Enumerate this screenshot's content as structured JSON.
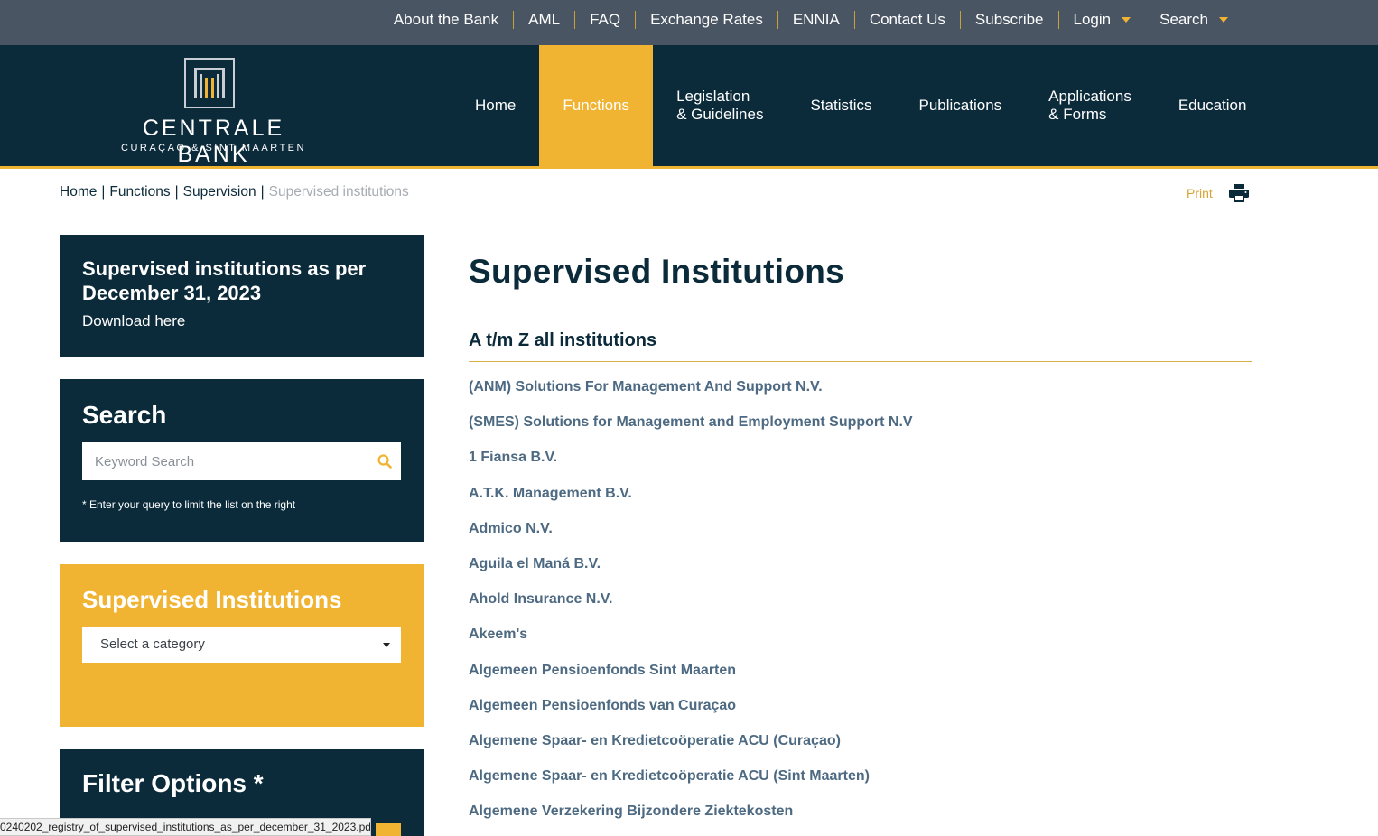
{
  "top_nav": [
    {
      "label": "About the Bank"
    },
    {
      "label": "AML"
    },
    {
      "label": "FAQ"
    },
    {
      "label": "Exchange Rates"
    },
    {
      "label": "ENNIA"
    },
    {
      "label": "Contact Us"
    },
    {
      "label": "Subscribe"
    },
    {
      "label": "Login"
    },
    {
      "label": "Search"
    }
  ],
  "logo": {
    "name": "CENTRALE BANK",
    "sub": "CURAÇAO & SINT MAARTEN"
  },
  "main_nav": [
    {
      "label": "Home"
    },
    {
      "label": "Functions"
    },
    {
      "label": "Legislation",
      "label2": "& Guidelines"
    },
    {
      "label": "Statistics"
    },
    {
      "label": "Publications"
    },
    {
      "label": "Applications",
      "label2": "& Forms"
    },
    {
      "label": "Education"
    }
  ],
  "breadcrumb": {
    "home": "Home",
    "functions": "Functions",
    "supervision": "Supervision",
    "current": "Supervised institutions",
    "sep": "|"
  },
  "print_label": "Print",
  "download_panel": {
    "title": "Supervised institutions as per December 31, 2023",
    "link": "Download here"
  },
  "search_panel": {
    "title": "Search",
    "placeholder": "Keyword Search",
    "note": "* Enter your query to limit the list on the right"
  },
  "category_panel": {
    "title": "Supervised Institutions",
    "select_value": "Select a category"
  },
  "filter_panel": {
    "title": "Filter Options *"
  },
  "content": {
    "title": "Supervised Institutions",
    "section": "A t/m Z all institutions",
    "institutions": [
      "(ANM) Solutions For Management And Support N.V.",
      "(SMES) Solutions for Management and Employment Support N.V",
      "1 Fiansa B.V.",
      "A.T.K. Management B.V.",
      "Admico N.V.",
      "Aguila el Maná B.V.",
      "Ahold Insurance N.V.",
      "Akeem's",
      "Algemeen Pensioenfonds Sint Maarten",
      "Algemeen Pensioenfonds van Curaçao",
      "Algemene Spaar- en Kredietcoöperatie ACU (Curaçao)",
      "Algemene Spaar- en Kredietcoöperatie ACU (Sint Maarten)",
      "Algemene Verzekering Bijzondere Ziektekosten"
    ]
  },
  "status_bar": "0240202_registry_of_supervised_institutions_as_per_december_31_2023.pdf",
  "colors": {
    "navy": "#0b2a3a",
    "gold": "#f0b432",
    "topbar": "#4a5563",
    "link": "#4d6a82"
  }
}
